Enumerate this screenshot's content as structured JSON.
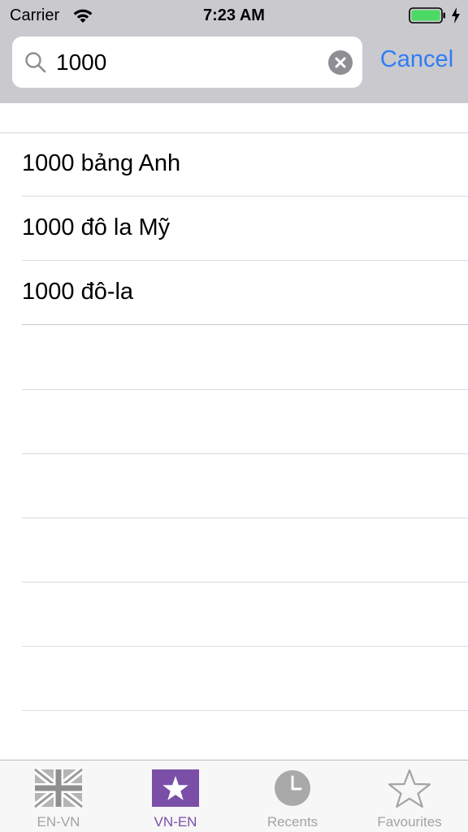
{
  "status_bar": {
    "carrier": "Carrier",
    "time": "7:23 AM"
  },
  "search": {
    "value": "1000",
    "cancel_label": "Cancel"
  },
  "results": [
    {
      "label": "1000 bảng Anh"
    },
    {
      "label": "1000 đô la Mỹ"
    },
    {
      "label": "1000 đô-la"
    }
  ],
  "tabs": [
    {
      "label": "EN-VN",
      "icon": "uk-flag-icon",
      "active": false
    },
    {
      "label": "VN-EN",
      "icon": "vn-flag-icon",
      "active": true
    },
    {
      "label": "Recents",
      "icon": "clock-icon",
      "active": false
    },
    {
      "label": "Favourites",
      "icon": "star-outline-icon",
      "active": false
    }
  ],
  "colors": {
    "header_bg": "#c9c9ce",
    "accent": "#2f7cf6",
    "active_tab": "#7b4fa8",
    "inactive_tab": "#a3a3a3",
    "battery": "#4cd964"
  }
}
